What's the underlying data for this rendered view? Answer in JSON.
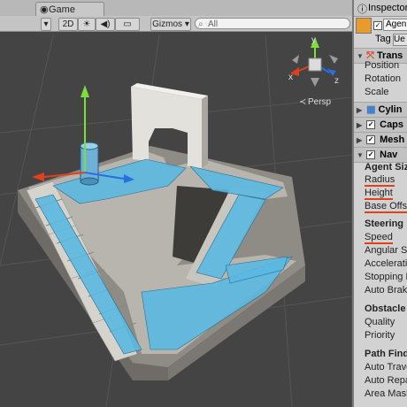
{
  "scene_tab": {
    "label": "Game"
  },
  "toolbar": {
    "mode_2d": "2D",
    "light_icon": "☀",
    "audio_icon": "◀)",
    "image_icon": "▭",
    "gizmos": "Gizmos",
    "search_placeholder": "All"
  },
  "gizmo": {
    "persp": "Persp",
    "x": "x",
    "y": "y",
    "z": "z"
  },
  "inspector": {
    "tab": "Inspector",
    "object_name": "Agen",
    "tag_label": "Tag",
    "tag_value": "Ue",
    "transform": {
      "title": "Trans",
      "position": "Position",
      "rotation": "Rotation",
      "scale": "Scale"
    },
    "cylinder": "Cylin",
    "capsule": "Caps",
    "mesh": "Mesh",
    "nav": "Nav",
    "agent_size": {
      "header": "Agent Size",
      "radius": "Radius",
      "height": "Height",
      "base_offset": "Base Offse"
    },
    "steering": {
      "header": "Steering",
      "speed": "Speed",
      "angular_speed": "Angular Sp",
      "acceleration": "Accelerati",
      "stopping": "Stopping D",
      "auto_braking": "Auto Braki"
    },
    "obstacle": {
      "header": "Obstacle A",
      "quality": "Quality",
      "priority": "Priority"
    },
    "pathfinding": {
      "header": "Path Findi",
      "auto_traverse": "Auto Trave",
      "auto_repath": "Auto Repat",
      "area_mask": "Area Mask"
    }
  },
  "colors": {
    "navmesh": "#5ab8e0",
    "annotation": "#e2401c",
    "scene_bg": "#444444"
  }
}
